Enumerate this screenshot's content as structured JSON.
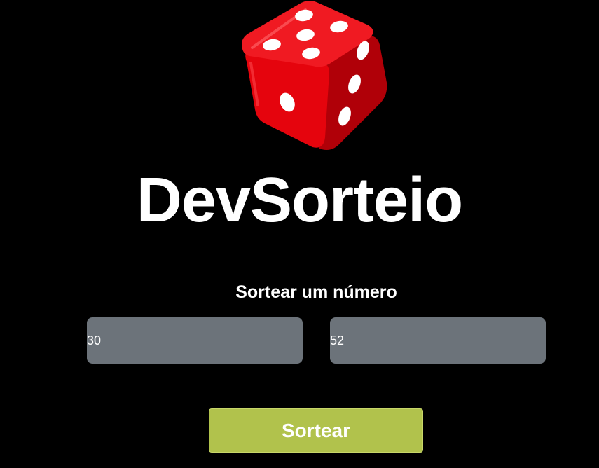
{
  "app": {
    "title": "DevSorteio",
    "logo_icon": "dice-icon"
  },
  "draw_form": {
    "heading": "Sortear um número",
    "min_value": "30",
    "max_value": "52",
    "submit_label": "Sortear"
  },
  "colors": {
    "background": "#000000",
    "dice_red": "#e5040d",
    "input_background": "#6c737a",
    "button_background": "#b1c24c",
    "text": "#ffffff"
  }
}
